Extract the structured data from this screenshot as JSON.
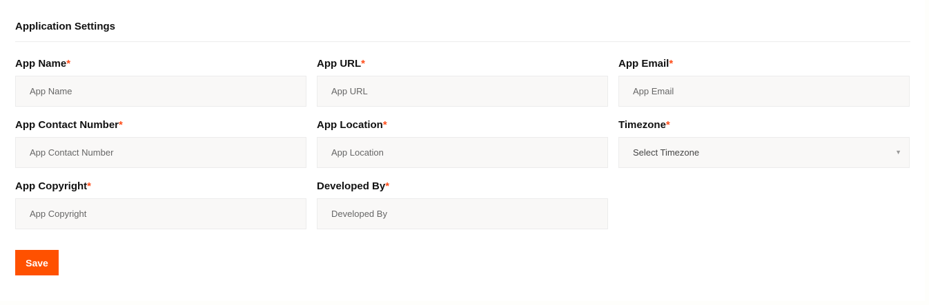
{
  "section": {
    "title": "Application Settings"
  },
  "required_mark": "*",
  "fields": {
    "app_name": {
      "label": "App Name",
      "placeholder": "App Name"
    },
    "app_url": {
      "label": "App URL",
      "placeholder": "App URL"
    },
    "app_email": {
      "label": "App Email",
      "placeholder": "App Email"
    },
    "app_contact_number": {
      "label": "App Contact Number",
      "placeholder": "App Contact Number"
    },
    "app_location": {
      "label": "App Location",
      "placeholder": "App Location"
    },
    "timezone": {
      "label": "Timezone",
      "selected": "Select Timezone"
    },
    "app_copyright": {
      "label": "App Copyright",
      "placeholder": "App Copyright"
    },
    "developed_by": {
      "label": "Developed By",
      "placeholder": "Developed By"
    }
  },
  "actions": {
    "save_label": "Save"
  },
  "colors": {
    "accent": "#ff5100",
    "required": "#ff4d1a",
    "input_bg": "#f9f8f7"
  },
  "icons": {
    "timezone_dropdown": "chevron-down-icon"
  }
}
